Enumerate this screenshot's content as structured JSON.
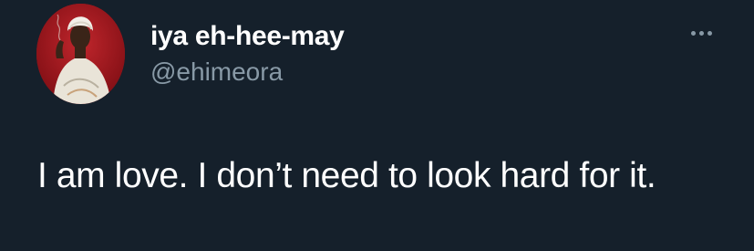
{
  "tweet": {
    "display_name": "iya eh-hee-may",
    "handle": "@ehimeora",
    "text": "I am love. I don’t need to look hard for it.",
    "more_icon": "more-horizontal-icon"
  },
  "colors": {
    "background": "#15202b",
    "primary_text": "#ffffff",
    "secondary_text": "#8899a6",
    "avatar_background": "#9b1218"
  }
}
